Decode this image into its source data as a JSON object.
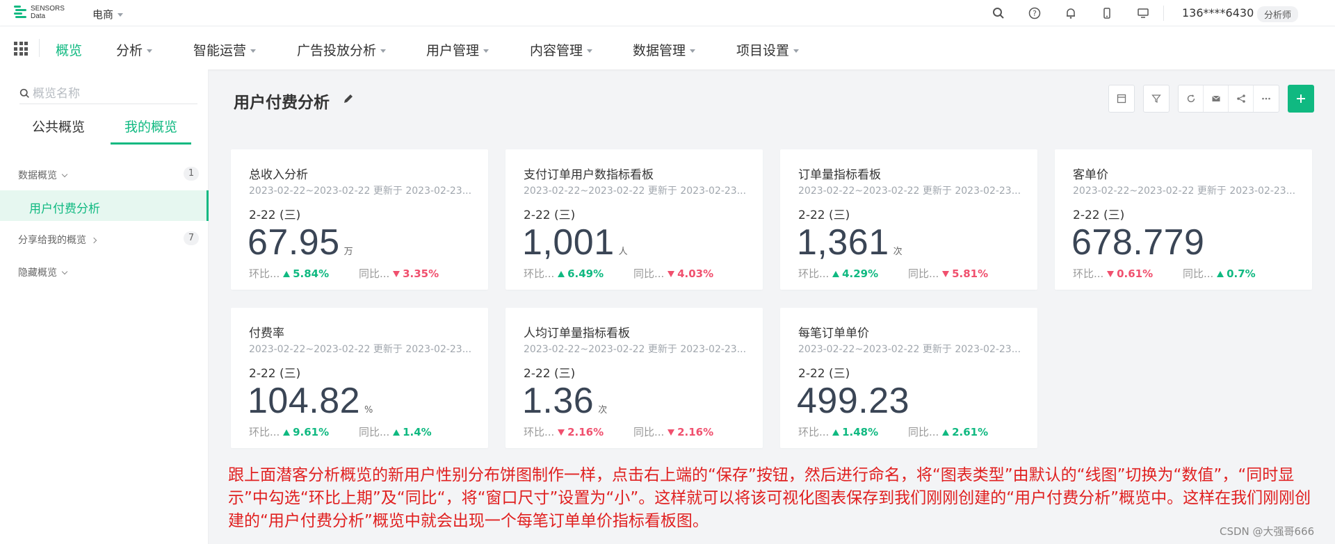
{
  "topbar": {
    "logo_line1": "SENSORS",
    "logo_line2": "Data",
    "project": "电商",
    "user": "136****6430",
    "role": "分析师"
  },
  "nav": {
    "items": [
      {
        "label": "概览",
        "dropdown": false,
        "active": true
      },
      {
        "label": "分析",
        "dropdown": true
      },
      {
        "label": "智能运营",
        "dropdown": true
      },
      {
        "label": "广告投放分析",
        "dropdown": true
      },
      {
        "label": "用户管理",
        "dropdown": true
      },
      {
        "label": "内容管理",
        "dropdown": true
      },
      {
        "label": "数据管理",
        "dropdown": true
      },
      {
        "label": "项目设置",
        "dropdown": true
      }
    ]
  },
  "sidebar": {
    "search_placeholder": "概览名称",
    "tabs": [
      "公共概览",
      "我的概览"
    ],
    "groups": [
      {
        "label": "数据概览",
        "count": "1"
      },
      {
        "label": "分享给我的概览",
        "count": "7"
      },
      {
        "label": "隐藏概览",
        "count": ""
      }
    ],
    "active_item": "用户付费分析"
  },
  "main": {
    "title": "用户付费分析",
    "cards": [
      {
        "title": "总收入分析",
        "meta": "2023-02-22~2023-02-22 更新于 2023-02-23...",
        "date": "2-22 (三)",
        "value": "67.95",
        "unit": "万",
        "cmp1_label": "环比...",
        "cmp1_value": "5.84%",
        "cmp1_dir": "up",
        "cmp2_label": "同比...",
        "cmp2_value": "3.35%",
        "cmp2_dir": "down"
      },
      {
        "title": "支付订单用户数指标看板",
        "meta": "2023-02-22~2023-02-22 更新于 2023-02-23...",
        "date": "2-22 (三)",
        "value": "1,001",
        "unit": "人",
        "cmp1_label": "环比...",
        "cmp1_value": "6.49%",
        "cmp1_dir": "up",
        "cmp2_label": "同比...",
        "cmp2_value": "4.03%",
        "cmp2_dir": "down"
      },
      {
        "title": "订单量指标看板",
        "meta": "2023-02-22~2023-02-22 更新于 2023-02-23...",
        "date": "2-22 (三)",
        "value": "1,361",
        "unit": "次",
        "cmp1_label": "环比...",
        "cmp1_value": "4.29%",
        "cmp1_dir": "up",
        "cmp2_label": "同比...",
        "cmp2_value": "5.81%",
        "cmp2_dir": "down"
      },
      {
        "title": "客单价",
        "meta": "2023-02-22~2023-02-22 更新于 2023-02-23...",
        "date": "2-22 (三)",
        "value": "678.779",
        "unit": "",
        "cmp1_label": "环比...",
        "cmp1_value": "0.61%",
        "cmp1_dir": "down",
        "cmp2_label": "同比...",
        "cmp2_value": "0.7%",
        "cmp2_dir": "up"
      },
      {
        "title": "付费率",
        "meta": "2023-02-22~2023-02-22 更新于 2023-02-23...",
        "date": "2-22 (三)",
        "value": "104.82",
        "unit": "%",
        "cmp1_label": "环比...",
        "cmp1_value": "9.61%",
        "cmp1_dir": "up",
        "cmp2_label": "同比...",
        "cmp2_value": "1.4%",
        "cmp2_dir": "up"
      },
      {
        "title": "人均订单量指标看板",
        "meta": "2023-02-22~2023-02-22 更新于 2023-02-23...",
        "date": "2-22 (三)",
        "value": "1.36",
        "unit": "次",
        "cmp1_label": "环比...",
        "cmp1_value": "2.16%",
        "cmp1_dir": "down",
        "cmp2_label": "同比...",
        "cmp2_value": "2.16%",
        "cmp2_dir": "down"
      },
      {
        "title": "每笔订单单价",
        "meta": "2023-02-22~2023-02-22 更新于 2023-02-23...",
        "date": "2-22 (三)",
        "value": "499.23",
        "unit": "",
        "cmp1_label": "环比...",
        "cmp1_value": "1.48%",
        "cmp1_dir": "up",
        "cmp2_label": "同比...",
        "cmp2_value": "2.61%",
        "cmp2_dir": "up"
      }
    ]
  },
  "annotation": "跟上面潜客分析概览的新用户性别分布饼图制作一样，点击右上端的“保存”按钮，然后进行命名，将“图表类型”由默认的“线图”切换为“数值”，“同时显示”中勾选“环比上期”及“同比“，将“窗口尺寸”设置为“小”。这样就可以将该可视化图表保存到我们刚刚创建的“用户付费分析”概览中。这样在我们刚刚创建的“用户付费分析”概览中就会出现一个每笔订单单价指标看板图。",
  "watermark": "CSDN @大强哥666",
  "colors": {
    "accent": "#10b981",
    "up": "#10b981",
    "down": "#f0506e",
    "annotation": "#e02020"
  }
}
